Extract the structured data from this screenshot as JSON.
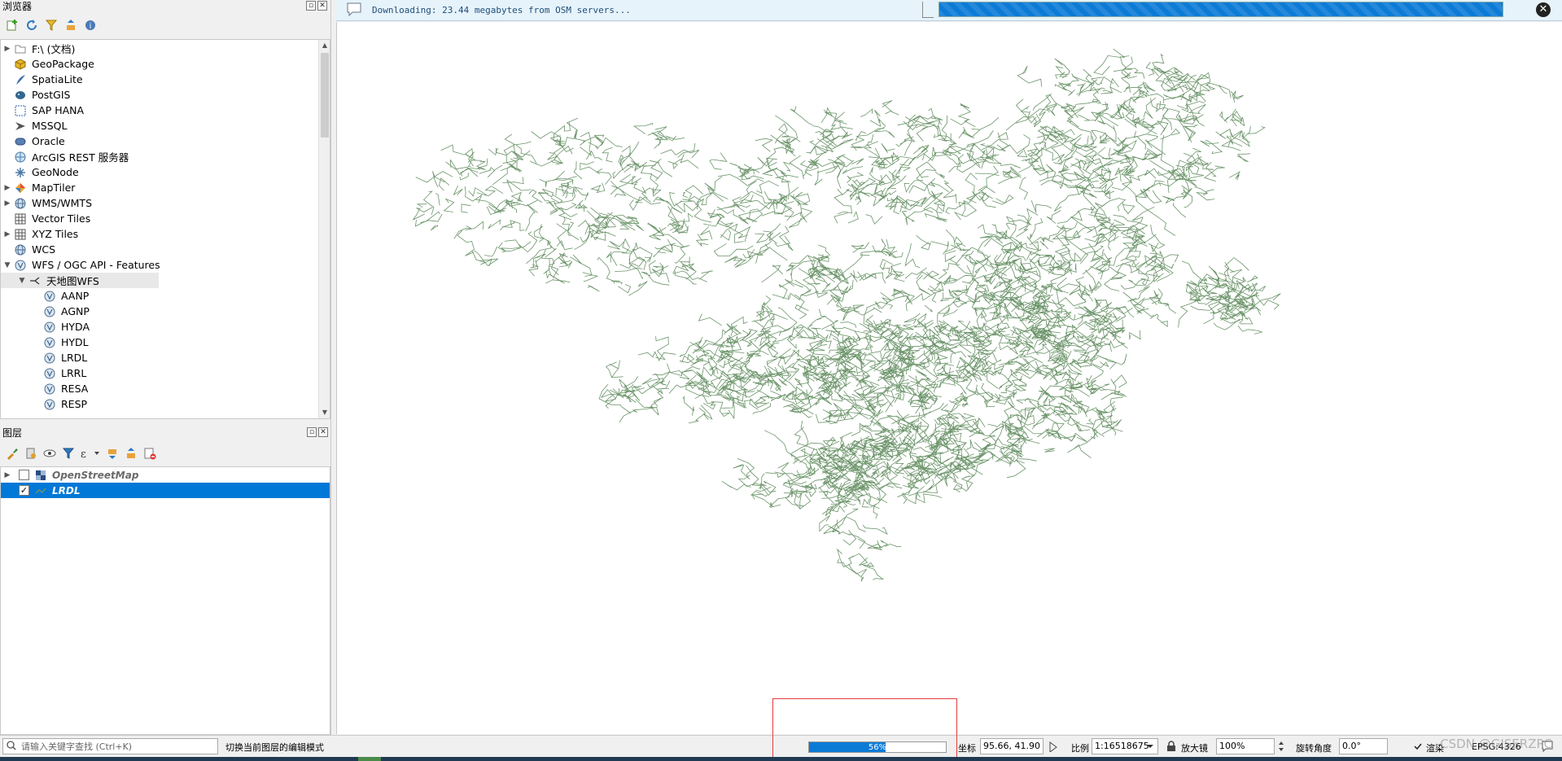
{
  "browser_panel": {
    "title": "浏览器",
    "toolbar_icons": [
      "add-layer-icon",
      "refresh-icon",
      "filter-icon",
      "collapse-icon",
      "help-icon"
    ],
    "items": [
      {
        "label": "F:\\ (文档)",
        "icon": "folder-icon",
        "expander": "collapsed",
        "indent": 0
      },
      {
        "label": "GeoPackage",
        "icon": "geopackage-icon",
        "expander": "none",
        "indent": 0
      },
      {
        "label": "SpatiaLite",
        "icon": "spatialite-icon",
        "expander": "none",
        "indent": 0
      },
      {
        "label": "PostGIS",
        "icon": "postgis-icon",
        "expander": "none",
        "indent": 0
      },
      {
        "label": "SAP HANA",
        "icon": "sap-hana-icon",
        "expander": "none",
        "indent": 0
      },
      {
        "label": "MSSQL",
        "icon": "mssql-icon",
        "expander": "none",
        "indent": 0
      },
      {
        "label": "Oracle",
        "icon": "oracle-icon",
        "expander": "none",
        "indent": 0
      },
      {
        "label": "ArcGIS REST 服务器",
        "icon": "arcgis-icon",
        "expander": "none",
        "indent": 0
      },
      {
        "label": "GeoNode",
        "icon": "geonode-icon",
        "expander": "none",
        "indent": 0
      },
      {
        "label": "MapTiler",
        "icon": "maptiler-icon",
        "expander": "collapsed",
        "indent": 0
      },
      {
        "label": "WMS/WMTS",
        "icon": "globe-icon",
        "expander": "collapsed",
        "indent": 0
      },
      {
        "label": "Vector Tiles",
        "icon": "grid-icon",
        "expander": "none",
        "indent": 0
      },
      {
        "label": "XYZ Tiles",
        "icon": "grid-icon",
        "expander": "collapsed",
        "indent": 0
      },
      {
        "label": "WCS",
        "icon": "globe-icon",
        "expander": "none",
        "indent": 0
      },
      {
        "label": "WFS / OGC API - Features",
        "icon": "wfs-icon",
        "expander": "expanded",
        "indent": 0
      },
      {
        "label": "天地图WFS",
        "icon": "connection-icon",
        "expander": "expanded",
        "indent": 1
      },
      {
        "label": "AANP",
        "icon": "wfs-icon",
        "expander": "none",
        "indent": 2
      },
      {
        "label": "AGNP",
        "icon": "wfs-icon",
        "expander": "none",
        "indent": 2
      },
      {
        "label": "HYDA",
        "icon": "wfs-icon",
        "expander": "none",
        "indent": 2
      },
      {
        "label": "HYDL",
        "icon": "wfs-icon",
        "expander": "none",
        "indent": 2
      },
      {
        "label": "LRDL",
        "icon": "wfs-icon",
        "expander": "none",
        "indent": 2
      },
      {
        "label": "LRRL",
        "icon": "wfs-icon",
        "expander": "none",
        "indent": 2
      },
      {
        "label": "RESA",
        "icon": "wfs-icon",
        "expander": "none",
        "indent": 2
      },
      {
        "label": "RESP",
        "icon": "wfs-icon",
        "expander": "none",
        "indent": 2
      }
    ]
  },
  "layers_panel": {
    "title": "图层",
    "toolbar_icons": [
      "style-icon",
      "add-group-icon",
      "eye-icon",
      "filter-icon",
      "expression-filter-icon",
      "expand-all-icon",
      "collapse-all-icon",
      "remove-layer-icon"
    ],
    "layers": [
      {
        "name": "OpenStreetMap",
        "checked": false,
        "active": false,
        "expander": "collapsed"
      },
      {
        "name": "LRDL",
        "checked": true,
        "active": true,
        "expander": "none"
      }
    ]
  },
  "message_bar": {
    "text": "Downloading: 23.44 megabytes from OSM servers...",
    "progress": 1.0,
    "close_icon": "close-icon"
  },
  "map": {
    "line_color": "#6b9469",
    "background": "#ffffff"
  },
  "statusbar": {
    "locator_placeholder": "请输入关键字查找 (Ctrl+K)",
    "message": "切换当前图层的编辑模式",
    "progress_value": 0.56,
    "progress_label": "56%",
    "coord_label": "坐标",
    "coord_value": "95.66, 41.90",
    "scale_label": "比例",
    "scale_value": "1:16518675",
    "magnifier_label": "放大镜",
    "magnifier_value": "100%",
    "rotation_label": "旋转角度",
    "rotation_value": "0.0°",
    "render_label": "渲染",
    "crs_label": "EPSG:4326"
  },
  "watermark": "CSDN @GISERZPC"
}
